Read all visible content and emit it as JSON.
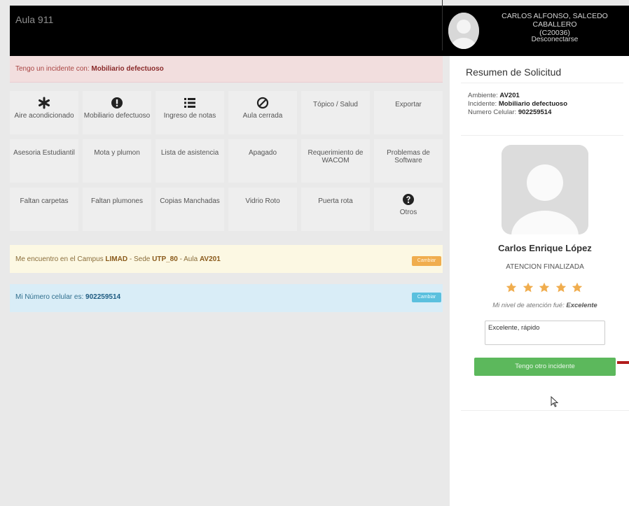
{
  "header": {
    "app_title": "Aula 911",
    "user_name": "CARLOS ALFONSO, SALCEDO CABALLERO",
    "user_code": "(C20036)",
    "logout_label": "Desconectarse"
  },
  "incident": {
    "prefix": "Tengo un incidente con:",
    "value": "Mobiliario defectuoso"
  },
  "options": [
    {
      "label": "Aire acondicionado",
      "icon": "asterisk-icon"
    },
    {
      "label": "Mobiliario defectuoso",
      "icon": "exclamation-circle-icon"
    },
    {
      "label": "Ingreso de notas",
      "icon": "list-icon"
    },
    {
      "label": "Aula cerrada",
      "icon": "ban-icon"
    },
    {
      "label": "Tópico / Salud",
      "icon": ""
    },
    {
      "label": "Exportar",
      "icon": ""
    },
    {
      "label": "Asesoria Estudiantil",
      "icon": ""
    },
    {
      "label": "Mota y plumon",
      "icon": ""
    },
    {
      "label": "Lista de asistencia",
      "icon": ""
    },
    {
      "label": "Apagado",
      "icon": ""
    },
    {
      "label": "Requerimiento de WACOM",
      "icon": ""
    },
    {
      "label": "Problemas de Software",
      "icon": ""
    },
    {
      "label": "Faltan carpetas",
      "icon": ""
    },
    {
      "label": "Faltan plumones",
      "icon": ""
    },
    {
      "label": "Copias Manchadas",
      "icon": ""
    },
    {
      "label": "Vidrio Roto",
      "icon": ""
    },
    {
      "label": "Puerta rota",
      "icon": ""
    },
    {
      "label": "Otros",
      "icon": "question-circle-icon"
    }
  ],
  "campus": {
    "prefix": "Me encuentro en el Campus",
    "campus": "LIMAD",
    "sede_prefix": "- Sede",
    "sede": "UTP_80",
    "aula_prefix": "- Aula",
    "aula": "AV201",
    "change_label": "Cambiar"
  },
  "phone": {
    "prefix": "Mi Número celular es:",
    "number": "902259514",
    "change_label": "Cambiar"
  },
  "summary": {
    "title": "Resumen de Solicitud",
    "ambiente_label": "Ambiente:",
    "ambiente": "AV201",
    "incidente_label": "Incidente:",
    "incidente": "Mobiliario defectuoso",
    "celular_label": "Numero Celular:",
    "celular": "902259514"
  },
  "agent": {
    "name": "Carlos Enrique López",
    "status": "ATENCION FINALIZADA",
    "rating_stars": 5,
    "rating_prefix": "Mi nivel de atención fué:",
    "rating_value": "Excelente",
    "comment": "Excelente, rápido",
    "new_incident_label": "Tengo otro incidente"
  },
  "colors": {
    "star": "#f0ad4e",
    "green": "#5cb85c",
    "orange": "#f0ad4e",
    "blue": "#5bc0de"
  }
}
